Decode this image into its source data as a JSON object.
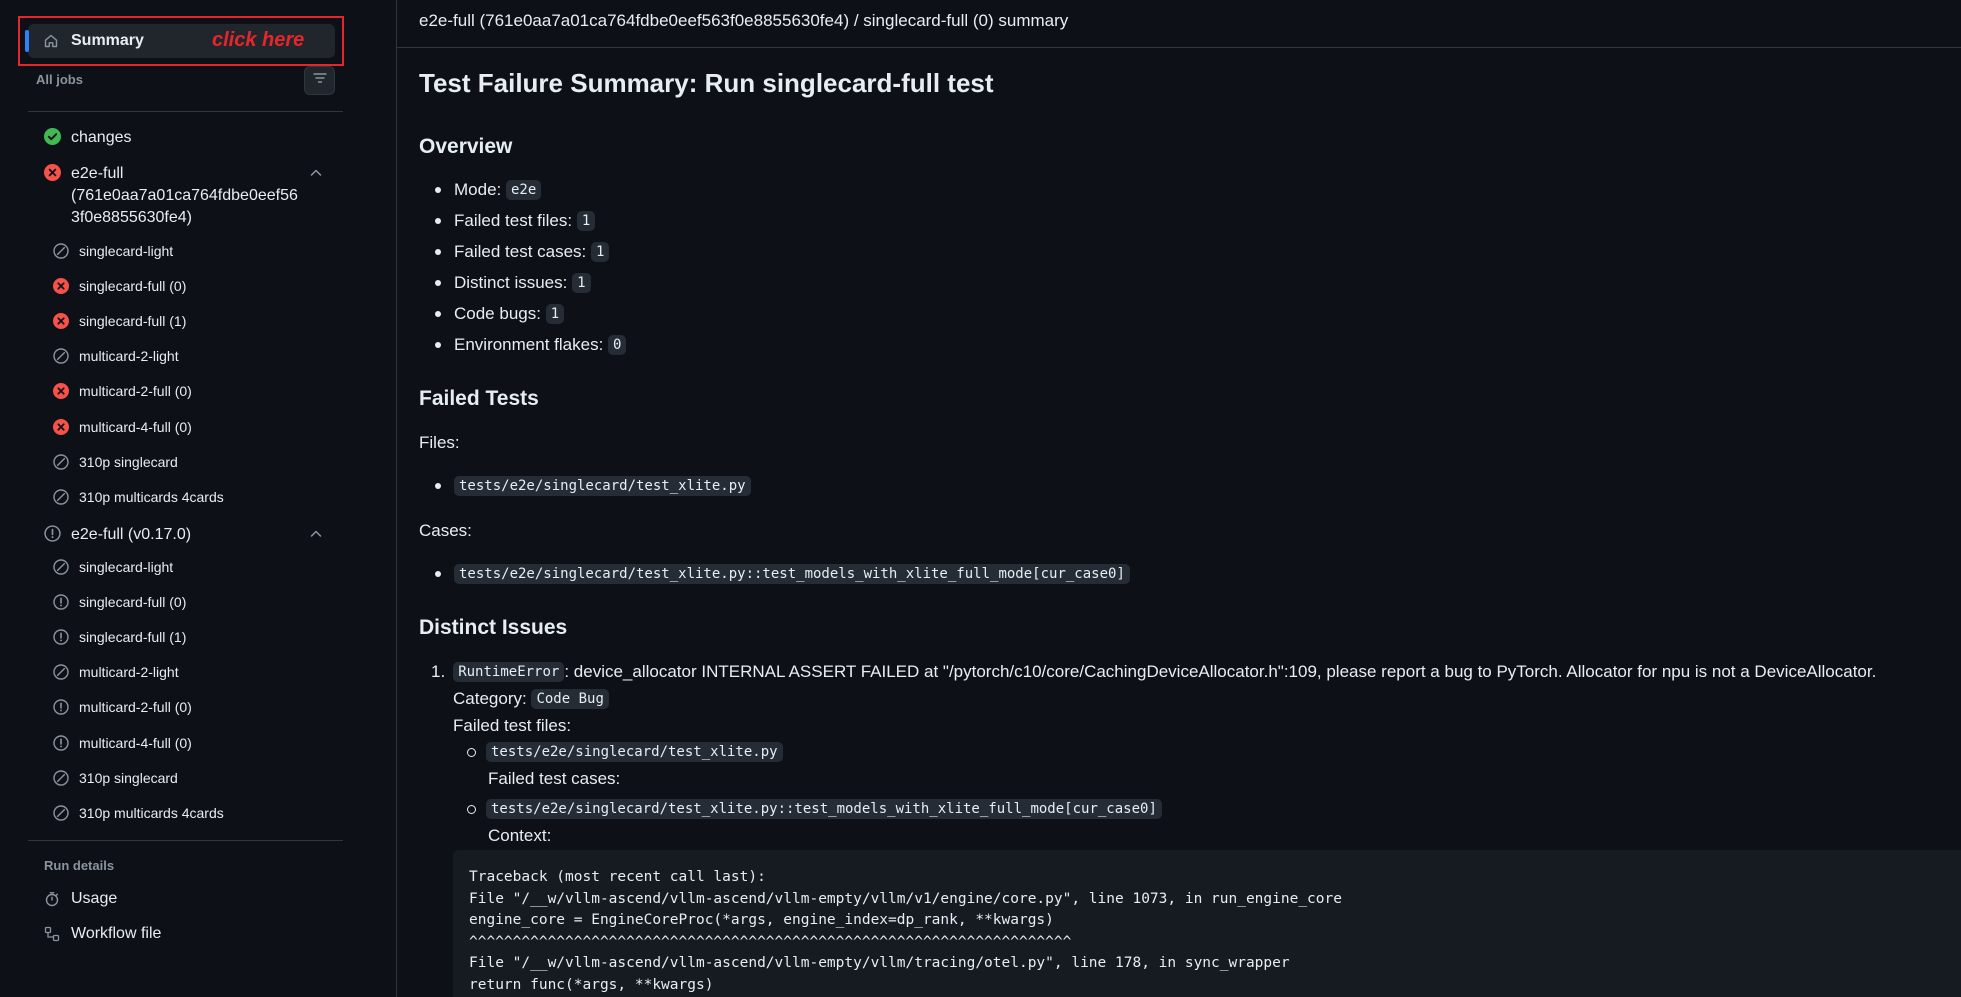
{
  "sidebar": {
    "summary_label": "Summary",
    "annotation": "click here",
    "all_jobs_label": "All jobs",
    "jobs": [
      {
        "name": "changes",
        "status": "success"
      },
      {
        "name": "e2e-full (761e0aa7a01ca764fdbe0eef563f0e8855630fe4)",
        "name_lines": [
          "e2e-full",
          "(761e0aa7a01ca764fdbe0eef56",
          "3f0e8855630fe4)"
        ],
        "status": "failure",
        "expanded": true,
        "children": [
          {
            "name": "singlecard-light",
            "status": "skipped"
          },
          {
            "name": "singlecard-full (0)",
            "status": "failure"
          },
          {
            "name": "singlecard-full (1)",
            "status": "failure"
          },
          {
            "name": "multicard-2-light",
            "status": "skipped"
          },
          {
            "name": "multicard-2-full (0)",
            "status": "failure"
          },
          {
            "name": "multicard-4-full (0)",
            "status": "failure"
          },
          {
            "name": "310p singlecard",
            "status": "skipped"
          },
          {
            "name": "310p multicards 4cards",
            "status": "skipped"
          }
        ]
      },
      {
        "name": "e2e-full (v0.17.0)",
        "status": "warning",
        "expanded": true,
        "children": [
          {
            "name": "singlecard-light",
            "status": "skipped"
          },
          {
            "name": "singlecard-full (0)",
            "status": "warning"
          },
          {
            "name": "singlecard-full (1)",
            "status": "warning"
          },
          {
            "name": "multicard-2-light",
            "status": "skipped"
          },
          {
            "name": "multicard-2-full (0)",
            "status": "warning"
          },
          {
            "name": "multicard-4-full (0)",
            "status": "warning"
          },
          {
            "name": "310p singlecard",
            "status": "skipped"
          },
          {
            "name": "310p multicards 4cards",
            "status": "skipped"
          }
        ]
      }
    ],
    "run_details_label": "Run details",
    "run_details": [
      {
        "label": "Usage",
        "icon": "stopwatch-icon"
      },
      {
        "label": "Workflow file",
        "icon": "workflow-file-icon"
      }
    ]
  },
  "header": {
    "breadcrumb": "e2e-full (761e0aa7a01ca764fdbe0eef563f0e8855630fe4) / singlecard-full (0) summary"
  },
  "report": {
    "title": "Test Failure Summary: Run singlecard-full test",
    "overview_heading": "Overview",
    "overview": [
      {
        "label": "Mode:",
        "value": "e2e"
      },
      {
        "label": "Failed test files:",
        "value": "1"
      },
      {
        "label": "Failed test cases:",
        "value": "1"
      },
      {
        "label": "Distinct issues:",
        "value": "1"
      },
      {
        "label": "Code bugs:",
        "value": "1"
      },
      {
        "label": "Environment flakes:",
        "value": "0"
      }
    ],
    "failed_tests_heading": "Failed Tests",
    "files_label": "Files:",
    "files": [
      "tests/e2e/singlecard/test_xlite.py"
    ],
    "cases_label": "Cases:",
    "cases": [
      "tests/e2e/singlecard/test_xlite.py::test_models_with_xlite_full_mode[cur_case0]"
    ],
    "distinct_issues_heading": "Distinct Issues",
    "issue": {
      "number": "1.",
      "error_type": "RuntimeError",
      "message": ": device_allocator INTERNAL ASSERT FAILED at \"/pytorch/c10/core/CachingDeviceAllocator.h\":109, please report a bug to PyTorch. Allocator for npu is not a DeviceAllocator.",
      "category_label": "Category:",
      "category": "Code Bug",
      "failed_files_label": "Failed test files:",
      "failed_file": "tests/e2e/singlecard/test_xlite.py",
      "failed_cases_label": "Failed test cases:",
      "failed_case": "tests/e2e/singlecard/test_xlite.py::test_models_with_xlite_full_mode[cur_case0]",
      "context_label": "Context:",
      "traceback": [
        "Traceback (most recent call last):",
        "File \"/__w/vllm-ascend/vllm-ascend/vllm-empty/vllm/v1/engine/core.py\", line 1073, in run_engine_core",
        "engine_core = EngineCoreProc(*args, engine_index=dp_rank, **kwargs)",
        "^^^^^^^^^^^^^^^^^^^^^^^^^^^^^^^^^^^^^^^^^^^^^^^^^^^^^^^^^^^^^^^^^^^^^",
        "File \"/__w/vllm-ascend/vllm-ascend/vllm-empty/vllm/tracing/otel.py\", line 178, in sync_wrapper",
        "return func(*args, **kwargs)"
      ]
    }
  },
  "colors": {
    "background": "#0d1117",
    "success": "#3fb950",
    "failure": "#f85149",
    "muted": "#8b949e",
    "accent": "#2f81f7",
    "annotation": "#e5262a"
  }
}
